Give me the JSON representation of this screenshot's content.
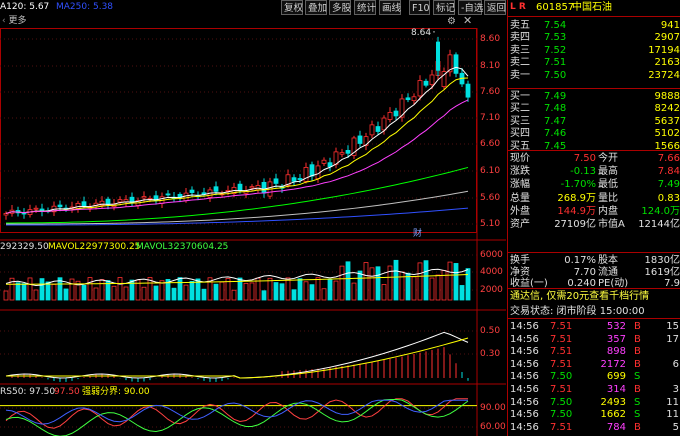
{
  "toolbar": {
    "left_text": "A120: 5.67",
    "left_text2": "MA250: 5.38",
    "buttons": [
      "复权",
      "叠加",
      "多股",
      "统计",
      "画线",
      "F10",
      "标记",
      "-自选",
      "返回"
    ],
    "gear_icon": "gear-icon",
    "close_icon": "close-icon"
  },
  "header": {
    "more_label": "更多",
    "stock_code": "601857",
    "stock_name": "中国石油",
    "flag_letters": "L R",
    "sub_letter": "融"
  },
  "price_axis": {
    "ticks": [
      "8.60",
      "8.10",
      "7.60",
      "7.10",
      "6.60",
      "6.10",
      "5.60",
      "5.10"
    ],
    "peak_label": "8.64"
  },
  "volume_panel": {
    "mavol1": "292329.50",
    "mavol2_label": "MAVOL2:",
    "mavol2": "2977300.25",
    "mavol3_label": "MAVOL3:",
    "mavol3": "2370604.25",
    "ticks": [
      "6000",
      "4000",
      "2000"
    ],
    "unit": "万",
    "marker": "财"
  },
  "macd_panel": {
    "ticks": [
      "0.50",
      "0.30"
    ]
  },
  "indicator_panel": {
    "left_label": "RS50: 97.50",
    "mid_value": "97.50",
    "strong_label": "强弱分界: 90.00",
    "ticks": [
      "90.00",
      "60.00"
    ]
  },
  "order_book": {
    "sell": [
      {
        "label": "卖五",
        "price": "7.54",
        "vol": "941"
      },
      {
        "label": "卖四",
        "price": "7.53",
        "vol": "2907"
      },
      {
        "label": "卖三",
        "price": "7.52",
        "vol": "17194"
      },
      {
        "label": "卖二",
        "price": "7.51",
        "vol": "2163"
      },
      {
        "label": "卖一",
        "price": "7.50",
        "vol": "23724"
      }
    ],
    "buy": [
      {
        "label": "买一",
        "price": "7.49",
        "vol": "9888"
      },
      {
        "label": "买二",
        "price": "7.48",
        "vol": "8242"
      },
      {
        "label": "买三",
        "price": "7.47",
        "vol": "5637"
      },
      {
        "label": "买四",
        "price": "7.46",
        "vol": "5102"
      },
      {
        "label": "买五",
        "price": "7.45",
        "vol": "1566"
      }
    ]
  },
  "quote": [
    {
      "l1": "现价",
      "v1": "7.50",
      "l2": "今开",
      "v2": "7.66"
    },
    {
      "l1": "涨跌",
      "v1": "-0.13",
      "l2": "最高",
      "v2": "7.84"
    },
    {
      "l1": "涨幅",
      "v1": "-1.70%",
      "l2": "最低",
      "v2": "7.49"
    },
    {
      "l1": "总量",
      "v1": "268.9万",
      "l2": "量比",
      "v2": "0.83"
    },
    {
      "l1": "外盘",
      "v1": "144.9万",
      "l2": "内盘",
      "v2": "124.0万"
    },
    {
      "l1": "资产",
      "v1": "27109亿",
      "l2": "市值A",
      "v2": "12144亿"
    },
    {
      "l1": "换手",
      "v1": "0.17%",
      "l2": "股本",
      "v2": "1830亿"
    },
    {
      "l1": "净资",
      "v1": "7.70",
      "l2": "流通",
      "v2": "1619亿"
    },
    {
      "l1": "收益(一)",
      "v1": "0.240",
      "l2": "PE(动)",
      "v2": "7.9"
    }
  ],
  "banner": {
    "text": "通达信, 仅需20元查看千档行情"
  },
  "status": {
    "text": "交易状态: 闭市阶段 15:00:00"
  },
  "ticks": [
    {
      "time": "14:56",
      "price": "7.51",
      "vol": "532",
      "side": "B"
    },
    {
      "time": "14:56",
      "price": "7.51",
      "vol": "357",
      "side": "B"
    },
    {
      "time": "14:56",
      "price": "7.51",
      "vol": "898",
      "side": "B"
    },
    {
      "time": "14:56",
      "price": "7.51",
      "vol": "2172",
      "side": "B"
    },
    {
      "time": "14:56",
      "price": "7.50",
      "vol": "699",
      "side": "S"
    },
    {
      "time": "14:56",
      "price": "7.51",
      "vol": "314",
      "side": "B"
    },
    {
      "time": "14:56",
      "price": "7.50",
      "vol": "2493",
      "side": "S"
    },
    {
      "time": "14:56",
      "price": "7.50",
      "vol": "1662",
      "side": "S"
    },
    {
      "time": "14:56",
      "price": "7.51",
      "vol": "784",
      "side": "B"
    }
  ],
  "tick_extra": [
    "15",
    "17",
    "",
    "6",
    "",
    "3",
    "11",
    "11",
    "5"
  ],
  "colors": {
    "up": "#ff3030",
    "down": "#00e0e0",
    "yellow": "#ffff00",
    "accent": "#ff3333",
    "bg": "#000000"
  }
}
